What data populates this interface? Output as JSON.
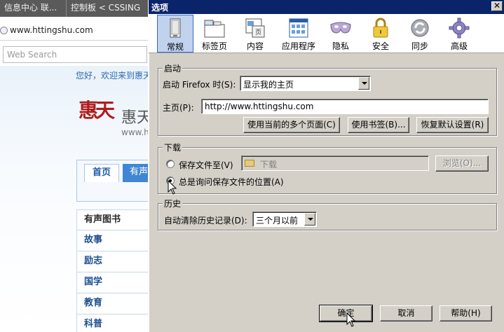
{
  "background": {
    "tabs": [
      "信息中心 联...",
      "控制板 < CSSING"
    ],
    "url": "www.httingshu.com",
    "search_placeholder": "Web Search",
    "welcome": "您好，欢迎来到惠天",
    "logo_seal": "惠天",
    "logo_text": "惠天",
    "logo_sub": "www.h",
    "nav_home": "首页",
    "nav_more": "有声",
    "categories": [
      "有声图书",
      "故事",
      "励志",
      "国学",
      "教育",
      "科普"
    ]
  },
  "dialog": {
    "title": "选项",
    "close": "✕",
    "toolbar": [
      {
        "label": "常规",
        "icon": "general-icon"
      },
      {
        "label": "标签页",
        "icon": "tabs-icon"
      },
      {
        "label": "内容",
        "icon": "content-icon"
      },
      {
        "label": "应用程序",
        "icon": "applications-icon"
      },
      {
        "label": "隐私",
        "icon": "privacy-mask-icon"
      },
      {
        "label": "安全",
        "icon": "security-lock-icon"
      },
      {
        "label": "同步",
        "icon": "sync-icon"
      },
      {
        "label": "高级",
        "icon": "advanced-gear-icon"
      }
    ],
    "startup": {
      "legend": "启动",
      "when_label": "启动 Firefox 时(S):",
      "when_value": "显示我的主页",
      "home_label": "主页(P):",
      "home_value": "http://www.httingshu.com",
      "btn_current": "使用当前的多个页面(C)",
      "btn_bookmark": "使用书签(B)...",
      "btn_restore": "恢复默认设置(R)"
    },
    "downloads": {
      "legend": "下载",
      "save_to_label": "保存文件至(V)",
      "save_to_folder": "下载",
      "browse": "浏览(O)...",
      "always_ask_label": "总是询问保存文件的位置(A)",
      "always_ask_checked": true
    },
    "history": {
      "legend": "历史",
      "clear_label": "自动清除历史记录(D):",
      "clear_value": "三个月以前"
    },
    "ok": "确定",
    "cancel": "取消",
    "help": "帮助(H)"
  }
}
